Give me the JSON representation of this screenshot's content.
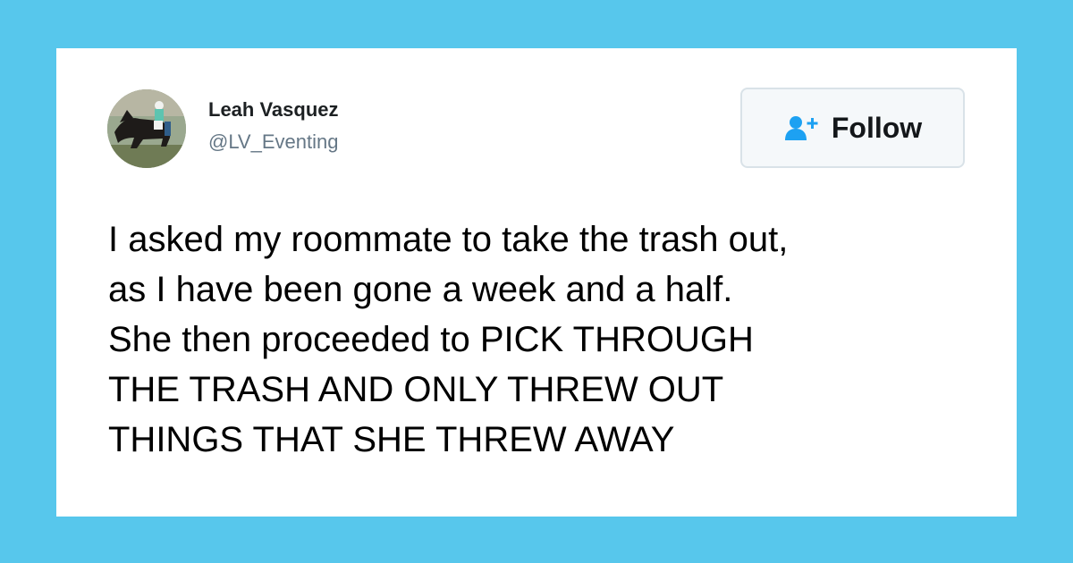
{
  "theme": {
    "background": "#57c7ec",
    "card": "#ffffff",
    "accent": "#1da1f2",
    "text": "#000000",
    "muted": "#657786"
  },
  "tweet": {
    "author": {
      "name": "Leah Vasquez",
      "handle": "@LV_Eventing",
      "avatar": "horse-rider-avatar"
    },
    "follow_button": {
      "label": "Follow",
      "icon": "add-user-icon"
    },
    "lines": [
      "I asked my roommate to take the trash out,",
      "as I have been gone a week and a half.",
      "She then proceeded to PICK THROUGH",
      "THE TRASH AND ONLY THREW OUT",
      "THINGS THAT SHE THREW AWAY"
    ]
  }
}
